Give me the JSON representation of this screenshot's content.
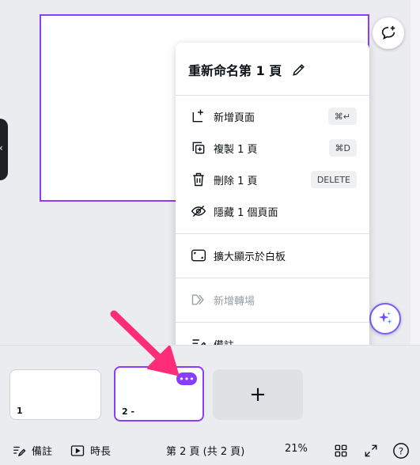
{
  "menu": {
    "title": "重新命名第 1 頁",
    "items": [
      {
        "label": "新增頁面",
        "shortcut": "⌘↵",
        "icon": "add-page-icon"
      },
      {
        "label": "複製 1 頁",
        "shortcut": "⌘D",
        "icon": "duplicate-icon"
      },
      {
        "label": "刪除 1 頁",
        "shortcut": "DELETE",
        "icon": "trash-icon"
      },
      {
        "label": "隱藏 1 個頁面",
        "icon": "eye-off-icon"
      },
      {
        "label": "擴大顯示於白板",
        "icon": "whiteboard-icon"
      },
      {
        "label": "新增轉場",
        "icon": "transition-icon",
        "disabled": true
      },
      {
        "label": "備註",
        "icon": "notes-icon"
      }
    ]
  },
  "pages": [
    {
      "number": "1"
    },
    {
      "number": "2 -",
      "selected": true,
      "more_label": "•••"
    }
  ],
  "add_page_label": "+",
  "toolbar": {
    "notes_label": "備註",
    "duration_label": "時長",
    "page_indicator": "第 2 頁 (共 2 頁)",
    "zoom": "21%",
    "help": "?"
  },
  "colors": {
    "accent": "#8b3dff",
    "arrow": "#ff2d78"
  }
}
